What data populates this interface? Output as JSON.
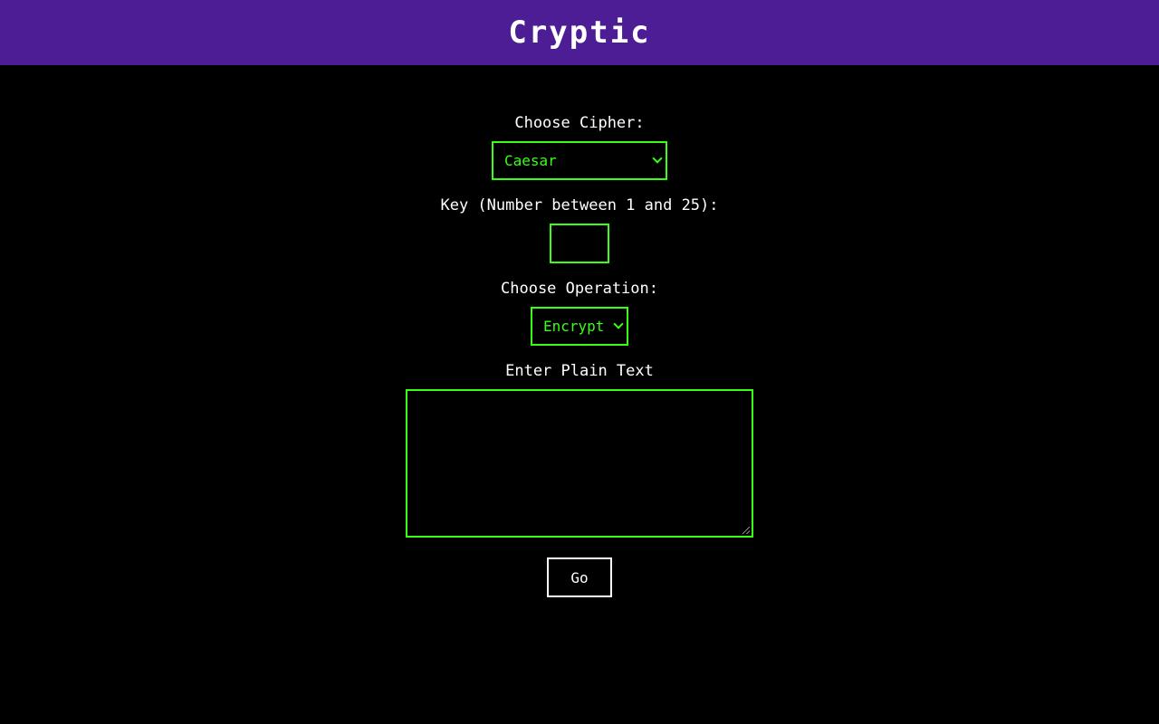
{
  "header": {
    "title": "Cryptic"
  },
  "form": {
    "cipher_label": "Choose Cipher:",
    "cipher_selected": "Caesar",
    "key_label": "Key (Number between 1 and 25):",
    "key_value": "",
    "operation_label": "Choose Operation:",
    "operation_selected": "Encrypt",
    "text_label": "Enter Plain Text",
    "text_value": "",
    "go_label": "Go"
  },
  "colors": {
    "header_bg": "#4c1d95",
    "accent": "#39ff14",
    "background": "#000000",
    "text": "#ffffff"
  },
  "icons": {
    "select_arrow": "chevron-down-icon",
    "textarea_grip": "resize-grip-icon"
  }
}
